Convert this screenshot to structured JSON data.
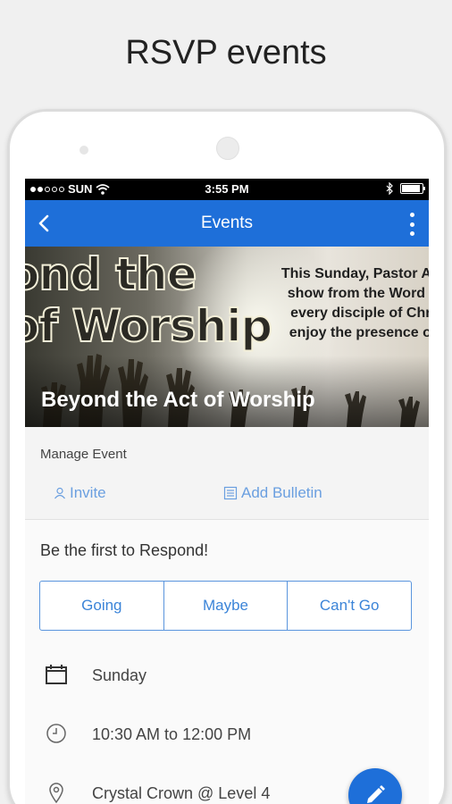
{
  "headline": "RSVP events",
  "status_bar": {
    "carrier": "SUN",
    "time": "3:55 PM"
  },
  "app_bar": {
    "title": "Events"
  },
  "banner": {
    "art_line1": "ond the",
    "art_line2": "of Worship",
    "art_text": [
      "This Sunday, Pastor Alb",
      "show from the Word o",
      "every disciple of Chri",
      "enjoy the presence of"
    ],
    "event_title": "Beyond the Act of Worship"
  },
  "manage_event": {
    "label": "Manage Event",
    "invite_label": "Invite",
    "add_bulletin_label": "Add Bulletin"
  },
  "respond_prompt": "Be the first to Respond!",
  "rsvp_options": {
    "going": "Going",
    "maybe": "Maybe",
    "cant_go": "Can't Go"
  },
  "details": {
    "day": "Sunday",
    "time_range": "10:30 AM to 12:00 PM",
    "location": "Crystal Crown @ Level 4"
  },
  "icons": {
    "back": "chevron-left-icon",
    "more": "more-vertical-icon",
    "invite": "person-icon",
    "bulletin": "list-icon",
    "calendar": "calendar-icon",
    "clock": "clock-icon",
    "location": "location-pin-icon",
    "edit": "pencil-icon"
  },
  "colors": {
    "primary": "#1e6fd9",
    "link": "#6a9fe0",
    "rsvp_border": "#5a95dd"
  }
}
